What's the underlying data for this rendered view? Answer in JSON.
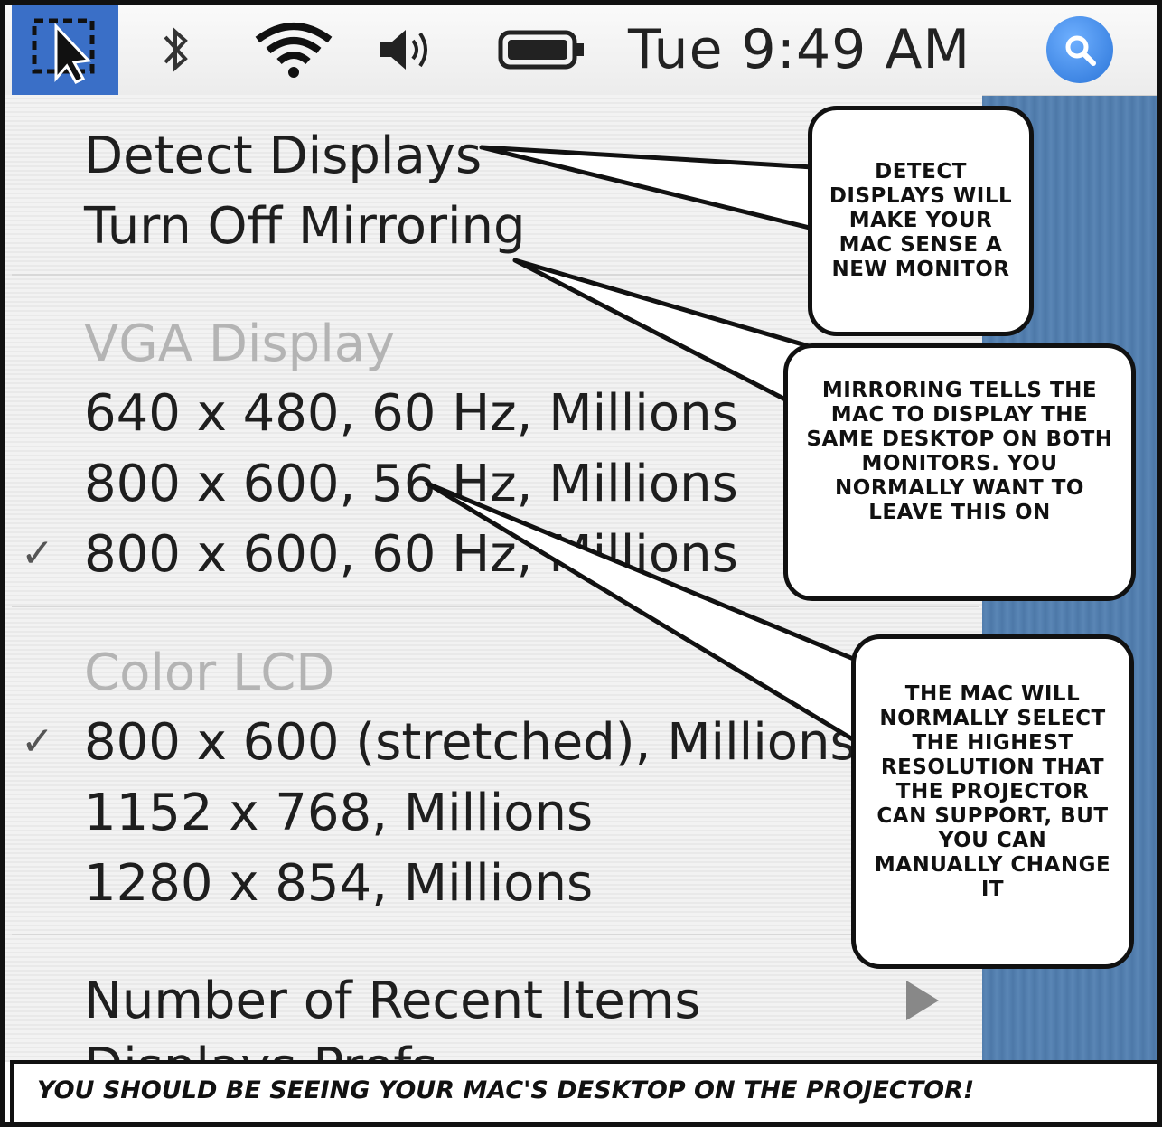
{
  "menubar": {
    "displays_icon": "displays-menu-icon",
    "bluetooth_glyph": "✱",
    "wifi_icon": "wifi-icon",
    "volume_icon": "volume-icon",
    "battery_icon": "battery-icon",
    "clock": "Tue 9:49 AM",
    "spotlight_icon": "spotlight-search-icon",
    "accent_color": "#3a6fc7"
  },
  "menu": {
    "detect_displays": "Detect Displays",
    "turn_off_mirroring": "Turn Off Mirroring",
    "vga_header": "VGA Display",
    "vga_modes": [
      "640 x 480, 60 Hz, Millions",
      "800 x 600, 56 Hz, Millions",
      "800 x 600, 60 Hz, Millions"
    ],
    "lcd_header": "Color LCD",
    "lcd_modes": [
      "800 x 600 (stretched), Millions",
      "1152 x 768, Millions",
      "1280 x 854, Millions"
    ],
    "checkmark": "✓",
    "recent_items": "Number of Recent Items",
    "display_prefs_partial": "Displays Prefs"
  },
  "callouts": {
    "detect": "Detect Displays will make your Mac sense a new monitor",
    "mirroring": "Mirroring tells the Mac to display the same desktop on both monitors. You normally want to leave this on",
    "resolution": "The Mac will normally select the highest resolution that the projector can support, but you can manually change it"
  },
  "caption": "You should be seeing your Mac's desktop on the projector!"
}
